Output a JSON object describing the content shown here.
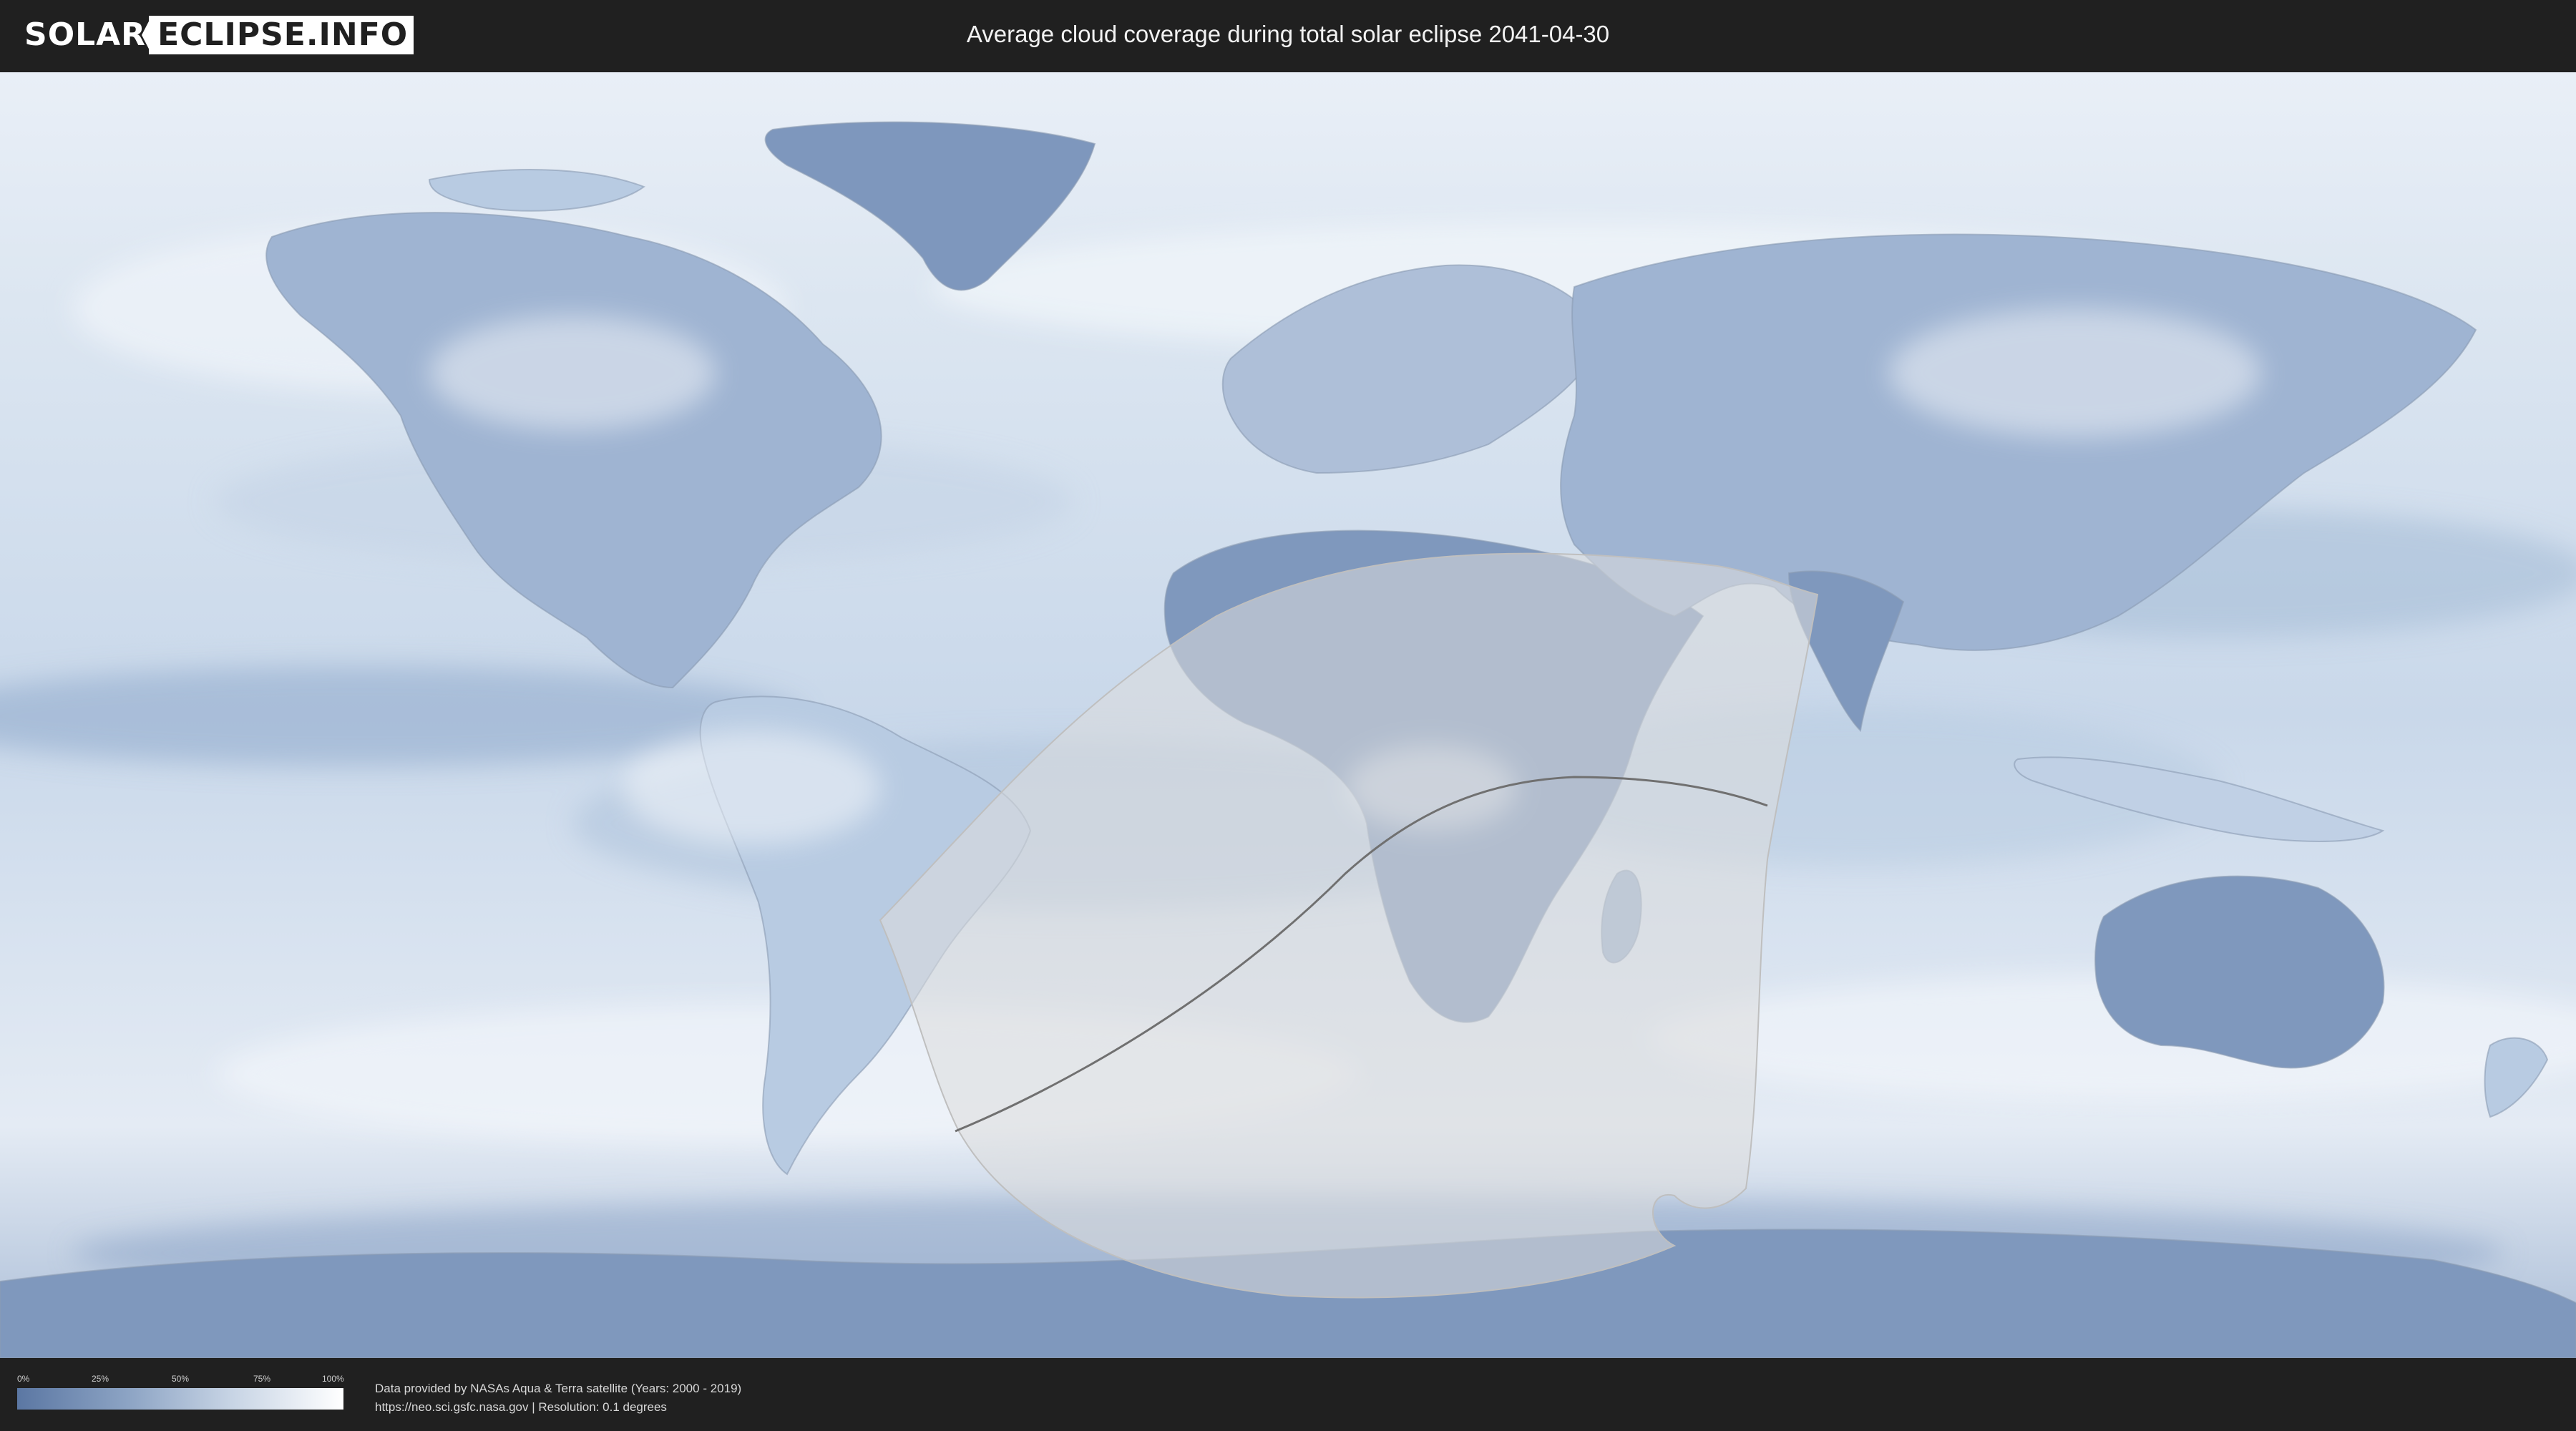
{
  "header": {
    "logo_left": "SOLAR",
    "logo_right": "ECLIPSE.INFO",
    "title": "Average cloud coverage during total solar eclipse 2041-04-30"
  },
  "map": {
    "colors": {
      "clear_sky": "#5b77a3",
      "cloud": "#ffffff",
      "ocean_mid": "#b9cbe0",
      "eclipse_zone": "#d9d9d9",
      "totality_path": "#707070"
    }
  },
  "legend": {
    "ticks": [
      "0%",
      "25%",
      "50%",
      "75%",
      "100%"
    ]
  },
  "credits": {
    "line1": "Data provided by NASAs Aqua & Terra satellite (Years: 2000 - 2019)",
    "line2": "https://neo.sci.gsfc.nasa.gov | Resolution: 0.1 degrees"
  }
}
